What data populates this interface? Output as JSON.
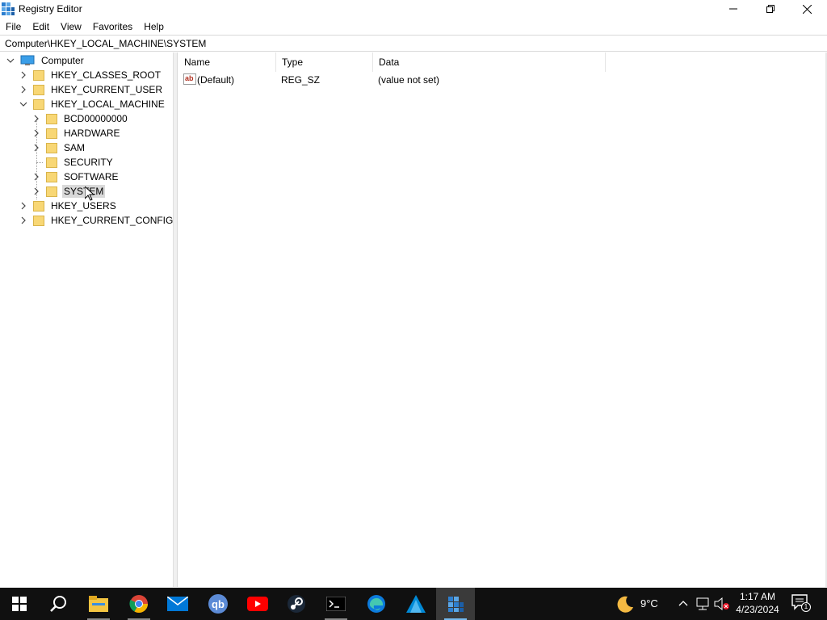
{
  "window": {
    "title": "Registry Editor",
    "icon": "registry-icon",
    "controls": [
      "minimize-icon",
      "restore-icon",
      "close-icon"
    ]
  },
  "menu": {
    "items": [
      "File",
      "Edit",
      "View",
      "Favorites",
      "Help"
    ]
  },
  "address": {
    "path": "Computer\\HKEY_LOCAL_MACHINE\\SYSTEM"
  },
  "tree": {
    "root": "Computer",
    "items": [
      {
        "label": "HKEY_CLASSES_ROOT"
      },
      {
        "label": "HKEY_CURRENT_USER"
      },
      {
        "label": "HKEY_LOCAL_MACHINE"
      },
      {
        "label": "BCD00000000"
      },
      {
        "label": "HARDWARE"
      },
      {
        "label": "SAM"
      },
      {
        "label": "SECURITY"
      },
      {
        "label": "SOFTWARE"
      },
      {
        "label": "SYSTEM"
      },
      {
        "label": "HKEY_USERS"
      },
      {
        "label": "HKEY_CURRENT_CONFIG"
      }
    ],
    "selected": "SYSTEM"
  },
  "list": {
    "columns": [
      "Name",
      "Type",
      "Data"
    ],
    "rows": [
      {
        "name": "(Default)",
        "type": "REG_SZ",
        "data": "(value not set)",
        "icon": "string-value-icon"
      }
    ]
  },
  "taskbar": {
    "apps": [
      "start-icon",
      "search-icon",
      "file-explorer-icon",
      "chrome-icon",
      "mail-icon",
      "qbittorrent-icon",
      "youtube-icon",
      "steam-icon",
      "terminal-icon",
      "edge-icon",
      "azure-icon",
      "registry-editor-icon"
    ],
    "qb_label": "qb",
    "weather": "9°C",
    "time": "1:17 AM",
    "date": "4/23/2024",
    "notification_count": "1",
    "colors": {
      "background": "#101010",
      "accent": "#0078d7"
    }
  }
}
